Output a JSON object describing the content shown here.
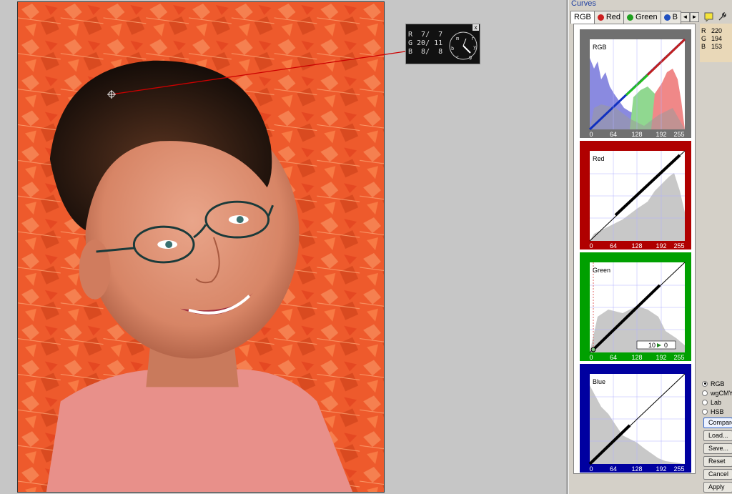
{
  "panel": {
    "title": "Curves",
    "tabs": [
      {
        "label": "RGB",
        "dot": ""
      },
      {
        "label": "Red",
        "dot": "#cc2020"
      },
      {
        "label": "Green",
        "dot": "#20a020"
      },
      {
        "label": "B",
        "dot": "#2050c0"
      }
    ],
    "tab_scroll_left": "◄",
    "tab_scroll_right": "►",
    "readout": {
      "r_label": "R",
      "r_value": "220",
      "g_label": "G",
      "g_value": "194",
      "b_label": "B",
      "b_value": "153"
    },
    "graphs": [
      {
        "label": "RGB",
        "frame_color": "#707070",
        "ticks": [
          "0",
          "64",
          "128",
          "192",
          "255"
        ]
      },
      {
        "label": "Red",
        "frame_color": "#b00000",
        "ticks": [
          "0",
          "64",
          "128",
          "192",
          "255"
        ]
      },
      {
        "label": "Green",
        "frame_color": "#00a000",
        "ticks": [
          "0",
          "64",
          "128",
          "192",
          "255"
        ],
        "in_value": "10",
        "out_value": "0"
      },
      {
        "label": "Blue",
        "frame_color": "#0000a0",
        "ticks": [
          "0",
          "64",
          "128",
          "192",
          "255"
        ]
      }
    ],
    "modes": [
      {
        "label": "RGB",
        "selected": true
      },
      {
        "label": "wgCMY",
        "selected": false
      },
      {
        "label": "Lab",
        "selected": false
      },
      {
        "label": "HSB",
        "selected": false
      }
    ],
    "buttons": {
      "compare": "Compare",
      "load": "Load...",
      "save": "Save...",
      "reset": "Reset",
      "cancel": "Cancel",
      "apply": "Apply"
    }
  },
  "info_window": {
    "close": "x",
    "rows": [
      "R  7/  7",
      "G 20/ 11",
      "B  8/  8"
    ],
    "dial_letters": [
      "m",
      "r",
      "y",
      "b",
      "c",
      "g"
    ]
  },
  "colors": {
    "accent": "#3366cc",
    "leaf": "#f0602e",
    "panel_bg": "#d4d0c8"
  }
}
